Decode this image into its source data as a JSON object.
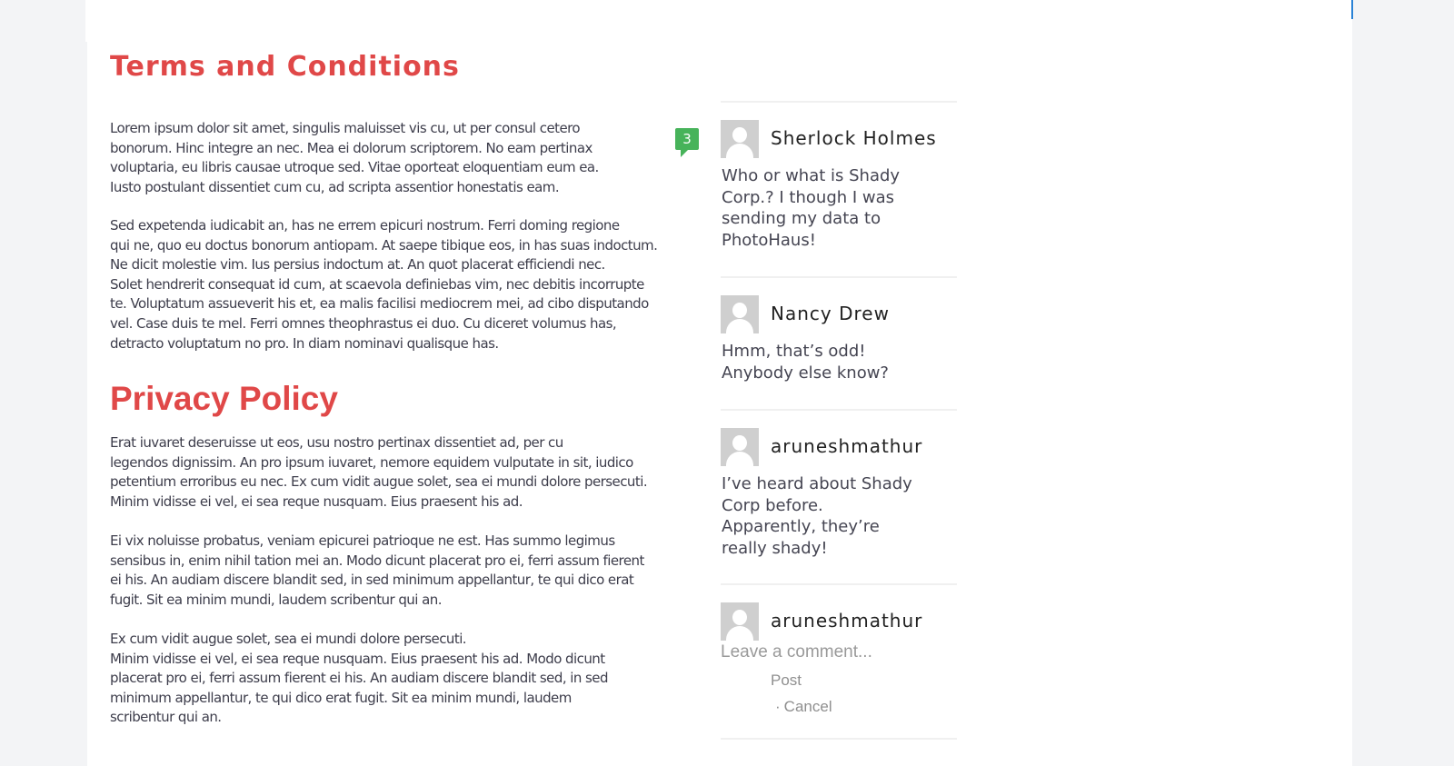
{
  "page": {
    "terms_title": "Terms and Conditions",
    "privacy_title": "Privacy Policy",
    "terms_paragraphs": [
      [
        "Lorem ipsum dolor sit amet, singulis maluisset vis cu, ut per consul cetero",
        "bonorum. Hinc integre an nec. Mea ei dolorum scriptorem. No eam pertinax",
        "voluptaria, eu libris causae utroque sed. Vitae oporteat eloquentiam eum ea.",
        "Iusto postulant dissentiet cum cu, ad scripta assentior honestatis eam."
      ],
      [
        "Sed expetenda iudicabit an, has ne errem epicuri nostrum. Ferri doming regione",
        "qui ne, quo eu doctus bonorum antiopam. At saepe tibique eos, in has suas indoctum.",
        "Ne dicit molestie vim. Ius persius indoctum at. An quot placerat efficiendi nec.",
        "Solet hendrerit consequat id cum, at scaevola definiebas vim, nec debitis incorrupte",
        "te. Voluptatum assueverit his et, ea malis facilisi mediocrem mei, ad cibo disputando",
        "vel. Case duis te mel. Ferri omnes theophrastus ei duo. Cu diceret volumus has,",
        "detracto voluptatum no pro. In diam nominavi qualisque has."
      ]
    ],
    "privacy_paragraphs": [
      [
        "Erat iuvaret deseruisse ut eos, usu nostro pertinax dissentiet ad, per cu",
        "legendos dignissim. An pro ipsum iuvaret, nemore equidem vulputate in sit, iudico",
        "petentium erroribus eu nec. Ex cum vidit augue solet, sea ei mundi dolore persecuti.",
        "Minim vidisse ei vel, ei sea reque nusquam. Eius praesent his ad."
      ],
      [
        "Ei vix noluisse probatus, veniam epicurei patrioque ne est. Has summo legimus",
        "sensibus in, enim nihil tation mei an. Modo dicunt placerat pro ei, ferri assum fierent",
        "ei his. An audiam discere blandit sed, in sed minimum appellantur, te qui dico erat",
        "fugit. Sit ea minim mundi, laudem scribentur qui an."
      ],
      [
        "Ex cum vidit augue solet, sea ei mundi dolore persecuti.",
        "Minim vidisse ei vel, ei sea reque nusquam. Eius praesent his ad. Modo dicunt",
        "placerat pro ei, ferri assum fierent ei his. An audiam discere blandit sed, in sed",
        "minimum appellantur, te qui dico erat fugit. Sit ea minim mundi, laudem",
        "scribentur qui an."
      ]
    ]
  },
  "comments": {
    "count_badge": "3",
    "items": [
      {
        "author": "Sherlock Holmes",
        "lines": [
          "Who or what is Shady",
          "Corp.? I though I was",
          "sending my data to",
          "PhotoHaus!"
        ]
      },
      {
        "author": "Nancy Drew",
        "lines": [
          "Hmm, that’s odd!",
          "Anybody else know?"
        ]
      },
      {
        "author": "aruneshmathur",
        "lines": [
          "I’ve heard about Shady",
          "Corp before.",
          "Apparently, they’re",
          "really shady!"
        ]
      }
    ],
    "composer": {
      "author": "aruneshmathur",
      "placeholder": "Leave a comment...",
      "post_label": "Post",
      "separator": "·",
      "cancel_label": "Cancel"
    }
  },
  "colors": {
    "heading_red": "#e04848",
    "badge_green": "#47b35a",
    "top_indicator_blue": "#2a82d6"
  },
  "icons": {
    "avatar": "default-user-silhouette-icon"
  }
}
